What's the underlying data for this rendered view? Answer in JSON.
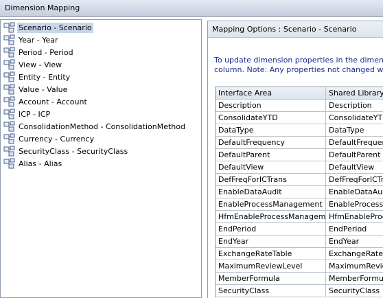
{
  "window": {
    "title": "Dimension Mapping"
  },
  "tree": {
    "items": [
      {
        "label": "Scenario - Scenario",
        "selected": true
      },
      {
        "label": "Year - Year"
      },
      {
        "label": "Period - Period"
      },
      {
        "label": "View - View"
      },
      {
        "label": "Entity - Entity"
      },
      {
        "label": "Value - Value"
      },
      {
        "label": "Account - Account"
      },
      {
        "label": "ICP - ICP"
      },
      {
        "label": "ConsolidationMethod - ConsolidationMethod"
      },
      {
        "label": "Currency - Currency"
      },
      {
        "label": "SecurityClass - SecurityClass"
      },
      {
        "label": "Alias - Alias"
      }
    ]
  },
  "mapping": {
    "title": "Mapping Options : Scenario - Scenario",
    "description_line1": "To update dimension properties in the dimension libr",
    "description_line2": "column.  Note: Any properties not changed will use",
    "columns": [
      "Interface Area",
      "Shared Library"
    ],
    "rows": [
      [
        "Description",
        "Description"
      ],
      [
        "ConsolidateYTD",
        "ConsolidateYTD"
      ],
      [
        "DataType",
        "DataType"
      ],
      [
        "DefaultFrequency",
        "DefaultFrequenc"
      ],
      [
        "DefaultParent",
        "DefaultParent"
      ],
      [
        "DefaultView",
        "DefaultView"
      ],
      [
        "DefFreqForICTrans",
        "DefFreqForICTrans"
      ],
      [
        "EnableDataAudit",
        "EnableDataAudit"
      ],
      [
        "EnableProcessManagement",
        "EnableProcessMa"
      ],
      [
        "HfmEnableProcessManagement",
        "HfmEnableProcess"
      ],
      [
        "EndPeriod",
        "EndPeriod"
      ],
      [
        "EndYear",
        "EndYear"
      ],
      [
        "ExchangeRateTable",
        "ExchangeRateTa"
      ],
      [
        "MaximumReviewLevel",
        "MaximumReview"
      ],
      [
        "MemberFormula",
        "MemberFormula"
      ],
      [
        "SecurityClass",
        "SecurityClass"
      ]
    ]
  },
  "icons": {
    "tree_item": "dimension-hierarchy-icon"
  },
  "colors": {
    "title_bar": "#c5cedd",
    "selection": "#c8d5ea",
    "description_text": "#1a2a8c"
  }
}
